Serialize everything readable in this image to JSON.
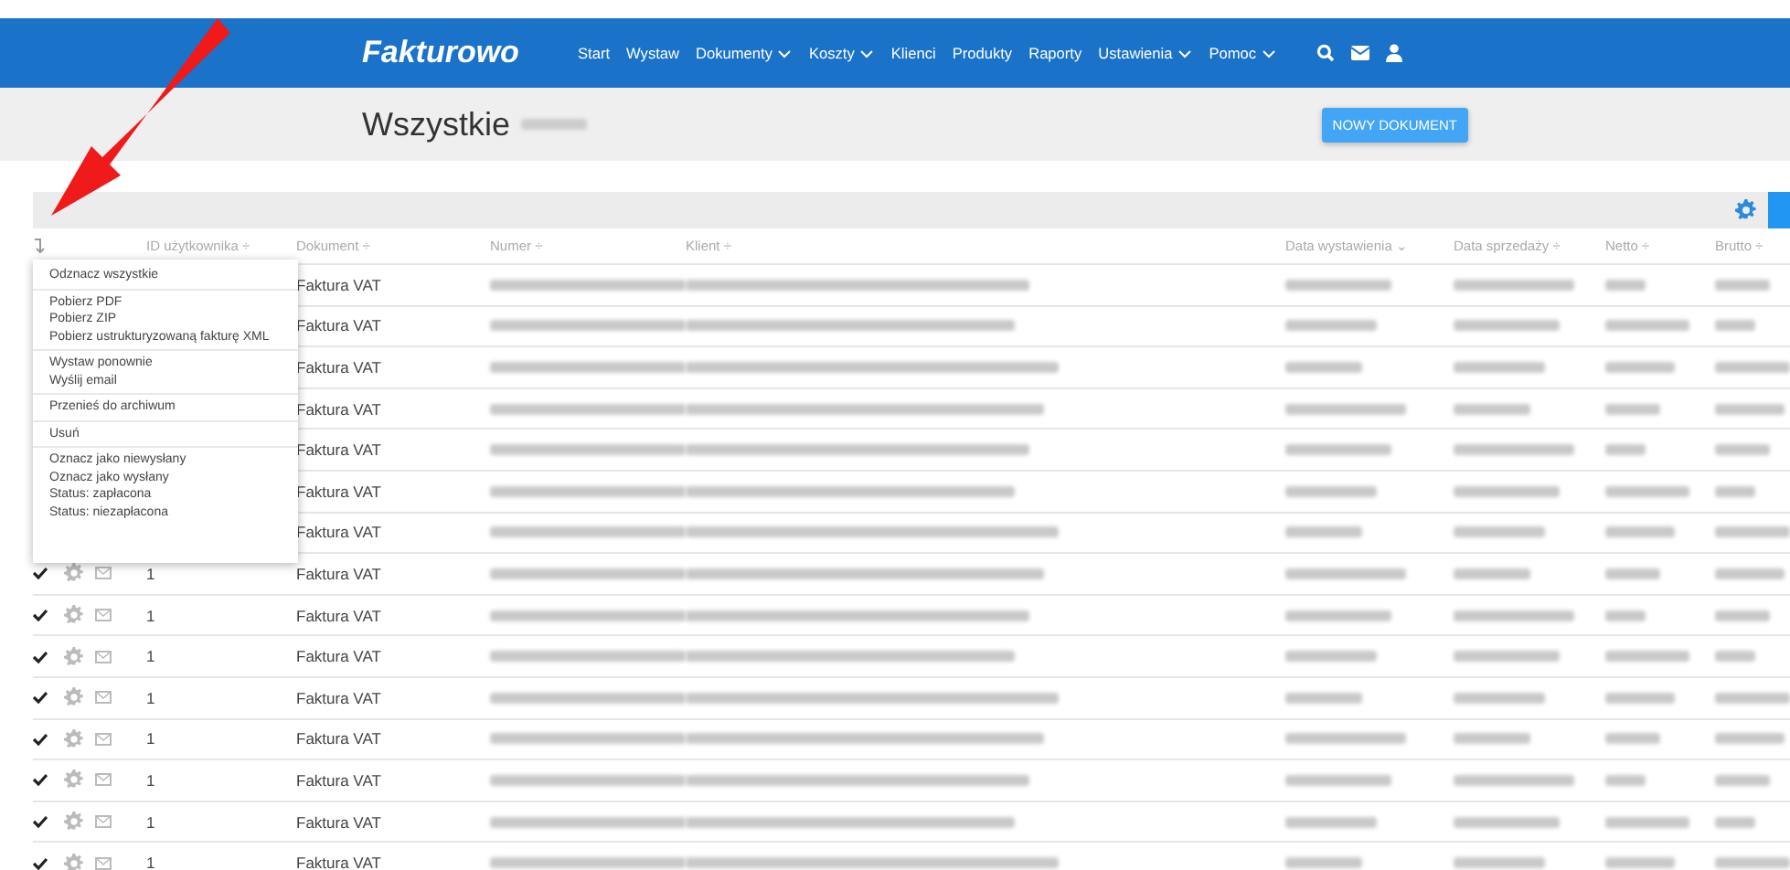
{
  "header": {
    "logo": "Fakturowo",
    "nav": [
      {
        "label": "Start",
        "dropdown": false
      },
      {
        "label": "Wystaw",
        "dropdown": false
      },
      {
        "label": "Dokumenty",
        "dropdown": true
      },
      {
        "label": "Koszty",
        "dropdown": true
      },
      {
        "label": "Klienci",
        "dropdown": false
      },
      {
        "label": "Produkty",
        "dropdown": false
      },
      {
        "label": "Raporty",
        "dropdown": false
      },
      {
        "label": "Ustawienia",
        "dropdown": true
      },
      {
        "label": "Pomoc",
        "dropdown": true
      }
    ],
    "icons": [
      {
        "kind": "search"
      },
      {
        "kind": "mail"
      },
      {
        "kind": "user"
      }
    ]
  },
  "page": {
    "title": "Wszystkie",
    "title_count_blurred": true,
    "new_button": "NOWY DOKUMENT"
  },
  "table": {
    "columns": [
      {
        "label": "ID użytkownika ÷",
        "blurred": false
      },
      {
        "label": "Dokument ÷",
        "blurred": false
      },
      {
        "label": "Numer ÷",
        "blurred": true
      },
      {
        "label": "Klient ÷",
        "blurred": true
      },
      {
        "label": "Data wystawienia ⌄",
        "blurred": true
      },
      {
        "label": "Data sprzedaży ÷",
        "blurred": true
      },
      {
        "label": "Netto ÷",
        "blurred": true
      },
      {
        "label": "Brutto ÷",
        "blurred": true
      }
    ],
    "rows": [
      {
        "covered": true,
        "document": "Faktura VAT"
      },
      {
        "covered": true,
        "document": "Faktura VAT"
      },
      {
        "covered": true,
        "document": "Faktura VAT"
      },
      {
        "covered": true,
        "document": "Faktura VAT"
      },
      {
        "covered": true,
        "document": "Faktura VAT"
      },
      {
        "covered": true,
        "document": "Faktura VAT"
      },
      {
        "covered": true,
        "document": "Faktura VAT"
      },
      {
        "covered": false,
        "checked": true,
        "user_id": "1",
        "document": "Faktura VAT"
      },
      {
        "covered": false,
        "checked": true,
        "user_id": "1",
        "document": "Faktura VAT"
      },
      {
        "covered": false,
        "checked": true,
        "user_id": "1",
        "document": "Faktura VAT"
      },
      {
        "covered": false,
        "checked": true,
        "user_id": "1",
        "document": "Faktura VAT"
      },
      {
        "covered": false,
        "checked": true,
        "user_id": "1",
        "document": "Faktura VAT"
      },
      {
        "covered": false,
        "checked": true,
        "user_id": "1",
        "document": "Faktura VAT"
      },
      {
        "covered": false,
        "checked": true,
        "user_id": "1",
        "document": "Faktura VAT"
      },
      {
        "covered": false,
        "checked": true,
        "user_id": "1",
        "document": "Faktura VAT"
      }
    ]
  },
  "menu": {
    "groups": [
      [
        "Odznacz wszystkie"
      ],
      [
        "Pobierz PDF",
        "Pobierz ZIP",
        "Pobierz ustrukturyzowaną fakturę XML"
      ],
      [
        "Wystaw ponownie",
        "Wyślij email"
      ],
      [
        "Przenieś do archiwum"
      ],
      [
        "Usuń"
      ],
      [
        "Oznacz jako niewysłany",
        "Oznacz jako wysłany",
        "Status: zapłacona",
        "Status: niezapłacona"
      ]
    ]
  },
  "annotation": {
    "kind": "arrow"
  }
}
